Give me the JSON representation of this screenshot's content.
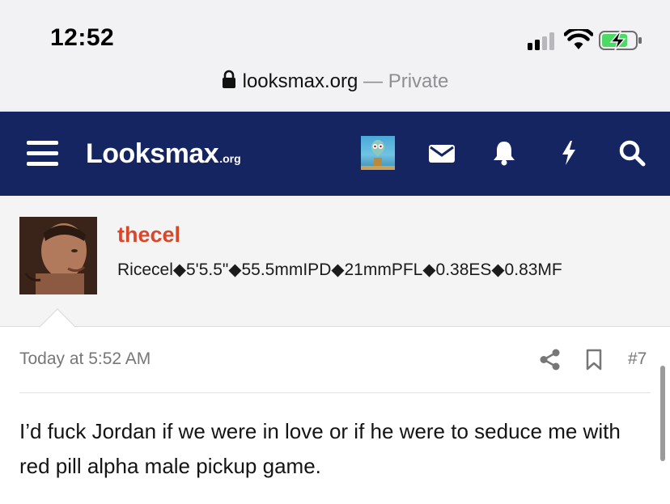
{
  "status_bar": {
    "time": "12:52",
    "url_host": "looksmax.org",
    "url_separator": " — ",
    "url_mode": "Private",
    "icons": [
      "signal-icon",
      "wifi-icon",
      "battery-charging-icon",
      "lock-icon"
    ]
  },
  "header": {
    "logo_main": "Looksmax",
    "logo_tld": ".org",
    "icons": [
      "menu-icon",
      "avatar",
      "mail-icon",
      "bell-icon",
      "lightning-icon",
      "search-icon"
    ],
    "bg_color": "#152561"
  },
  "profile": {
    "username": "thecel",
    "username_color": "#d9472b",
    "title": "Ricecel◆5'5.5\"◆55.5mmIPD◆21mmPFL◆0.38ES◆0.83MF"
  },
  "post": {
    "timestamp": "Today at 5:52 AM",
    "number": "#7",
    "body": "I’d fuck Jordan if we were in love or if he were to seduce me with red pill alpha male pickup game."
  }
}
